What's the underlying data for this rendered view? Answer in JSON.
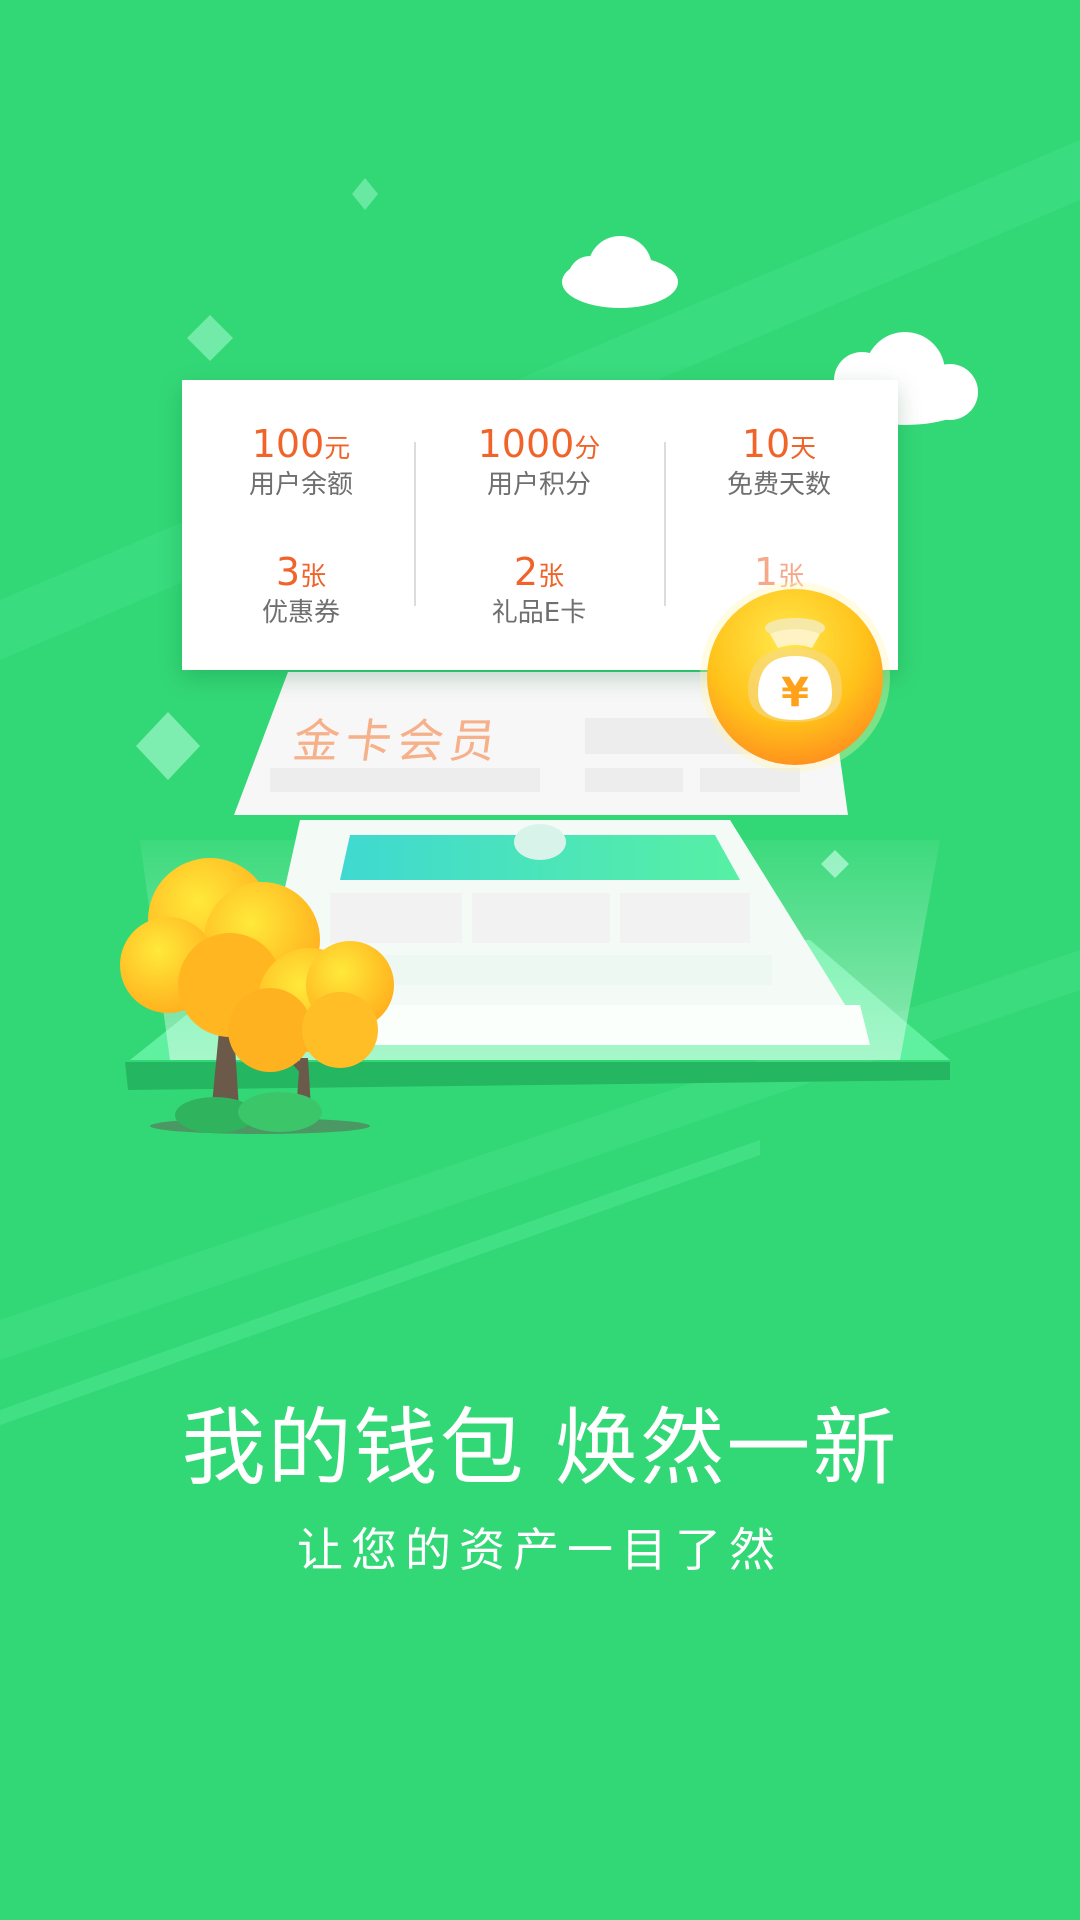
{
  "card": {
    "stats": [
      {
        "value": "100",
        "unit": "元",
        "label": "用户余额"
      },
      {
        "value": "1000",
        "unit": "分",
        "label": "用户积分"
      },
      {
        "value": "10",
        "unit": "天",
        "label": "免费天数"
      },
      {
        "value": "3",
        "unit": "张",
        "label": "优惠券"
      },
      {
        "value": "2",
        "unit": "张",
        "label": "礼品E卡"
      },
      {
        "value": "1",
        "unit": "张",
        "label": ""
      }
    ]
  },
  "illustration": {
    "member_label": "金卡会员",
    "coin_symbol": "¥"
  },
  "headline": "我的钱包 焕然一新",
  "subline": "让您的资产一目了然",
  "colors": {
    "background": "#33d876",
    "accent_orange": "#f0642a",
    "coin_gold": "#ffc21a"
  }
}
